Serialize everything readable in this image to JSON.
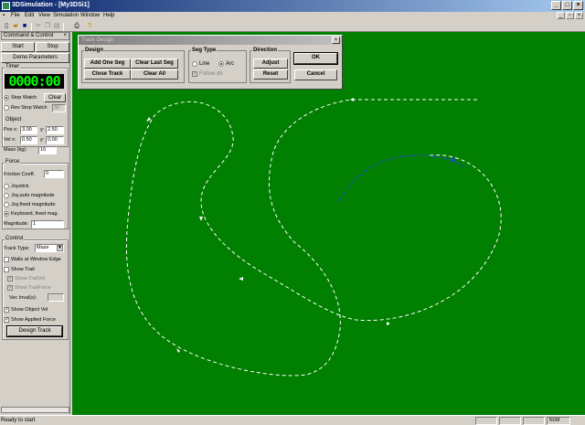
{
  "window": {
    "title": "3DSimulation - [My3DSi1]",
    "buttons": [
      "_",
      "□",
      "×"
    ]
  },
  "menu": [
    "File",
    "Edit",
    "View",
    "Simulation",
    "Window",
    "Help"
  ],
  "toolbar": [
    "new-icon",
    "open-icon",
    "save-icon",
    "cut-icon",
    "copy-icon",
    "paste-icon",
    "print-icon",
    "help-icon"
  ],
  "panel": {
    "title": "Command & Control",
    "close": "×",
    "start": "Start",
    "stop": "Stop",
    "demo": "Demo Parameters",
    "timer_label": "Timer",
    "timer_value": "0000:00",
    "stop_watch": "Stop Watch",
    "clear": "Clear",
    "rev_stop_watch": "Rev Stop Watch",
    "rev_value": "30",
    "object_label": "Object",
    "pos_x_label": "Pos x:",
    "pos_x": "3.00",
    "pos_y_label": "y:",
    "pos_y": "2.50",
    "vel_x_label": "Vel x:",
    "vel_x": "0.50",
    "vel_y_label": "y:",
    "vel_y": "0.00",
    "mass_label": "Mass (kg):",
    "mass": "10",
    "force_label": "Force",
    "friction_label": "Friction Coeff.",
    "friction": "0",
    "joystick": "Joystick",
    "joy_auto": "Joy,auto magnitude",
    "joy_fixed": "Joy,fixed magnitude",
    "keyboard": "Keyboard, fixed mag.",
    "magnitude_label": "Magnitude:",
    "magnitude": "1",
    "control_label": "Control",
    "track_type_label": "Track Type:",
    "track_type": "Maze",
    "walls": "Walls at Window Edge",
    "show_trail": "Show Trail",
    "show_trail_vel": "Show TrailVel",
    "show_trail_force": "Show TrailForce",
    "vec_inval": "Vec Inval(s):",
    "show_object_vel": "Show Object Vel",
    "show_applied_force": "Show Applied Force",
    "design_track": "Design Track"
  },
  "dialog": {
    "title": "Track Design",
    "close": "×",
    "design_label": "Design",
    "add_one_seg": "Add One Seg",
    "clear_last_seg": "Clear Last Seg",
    "close_track": "Close Track",
    "clear_all": "Clear All",
    "seg_type_label": "Seg Type",
    "line": "Line",
    "arc": "Arc",
    "follow_dir": "Follow dir",
    "direction_label": "Direction",
    "adjust": "Adjust",
    "reset": "Reset",
    "ok": "OK",
    "cancel": "Cancel"
  },
  "status": {
    "text": "Ready to start",
    "num": "NUM"
  },
  "colors": {
    "canvas": "#007f00",
    "track": "#ffffff",
    "arc_preview": "#1e50c8",
    "timer_digits": "#00ff00"
  }
}
